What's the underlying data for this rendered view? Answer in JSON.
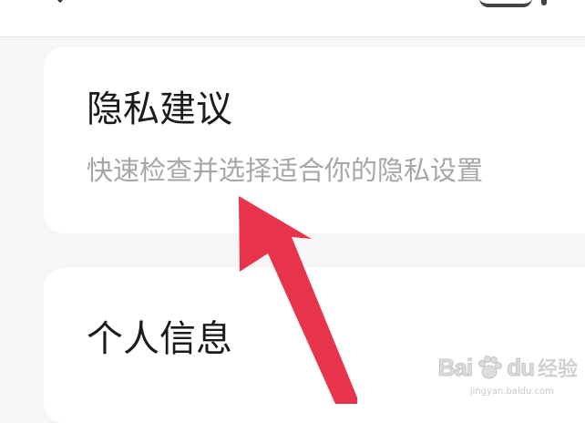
{
  "privacy_card": {
    "title": "隐私建议",
    "subtitle": "快速检查并选择适合你的隐私设置"
  },
  "personal_card": {
    "title": "个人信息"
  },
  "watermark": {
    "brand": "Bai",
    "brand_suffix": "du",
    "product": "经验",
    "url": "jingyan.baidu.com"
  },
  "colors": {
    "arrow": "#e8344a",
    "title": "#1b1b1b",
    "subtitle": "#a6a6a6",
    "background": "#f6f6f6",
    "card": "#ffffff"
  },
  "icons": {
    "annotation": "red-arrow-icon",
    "watermark": "baidu-paw-icon"
  }
}
